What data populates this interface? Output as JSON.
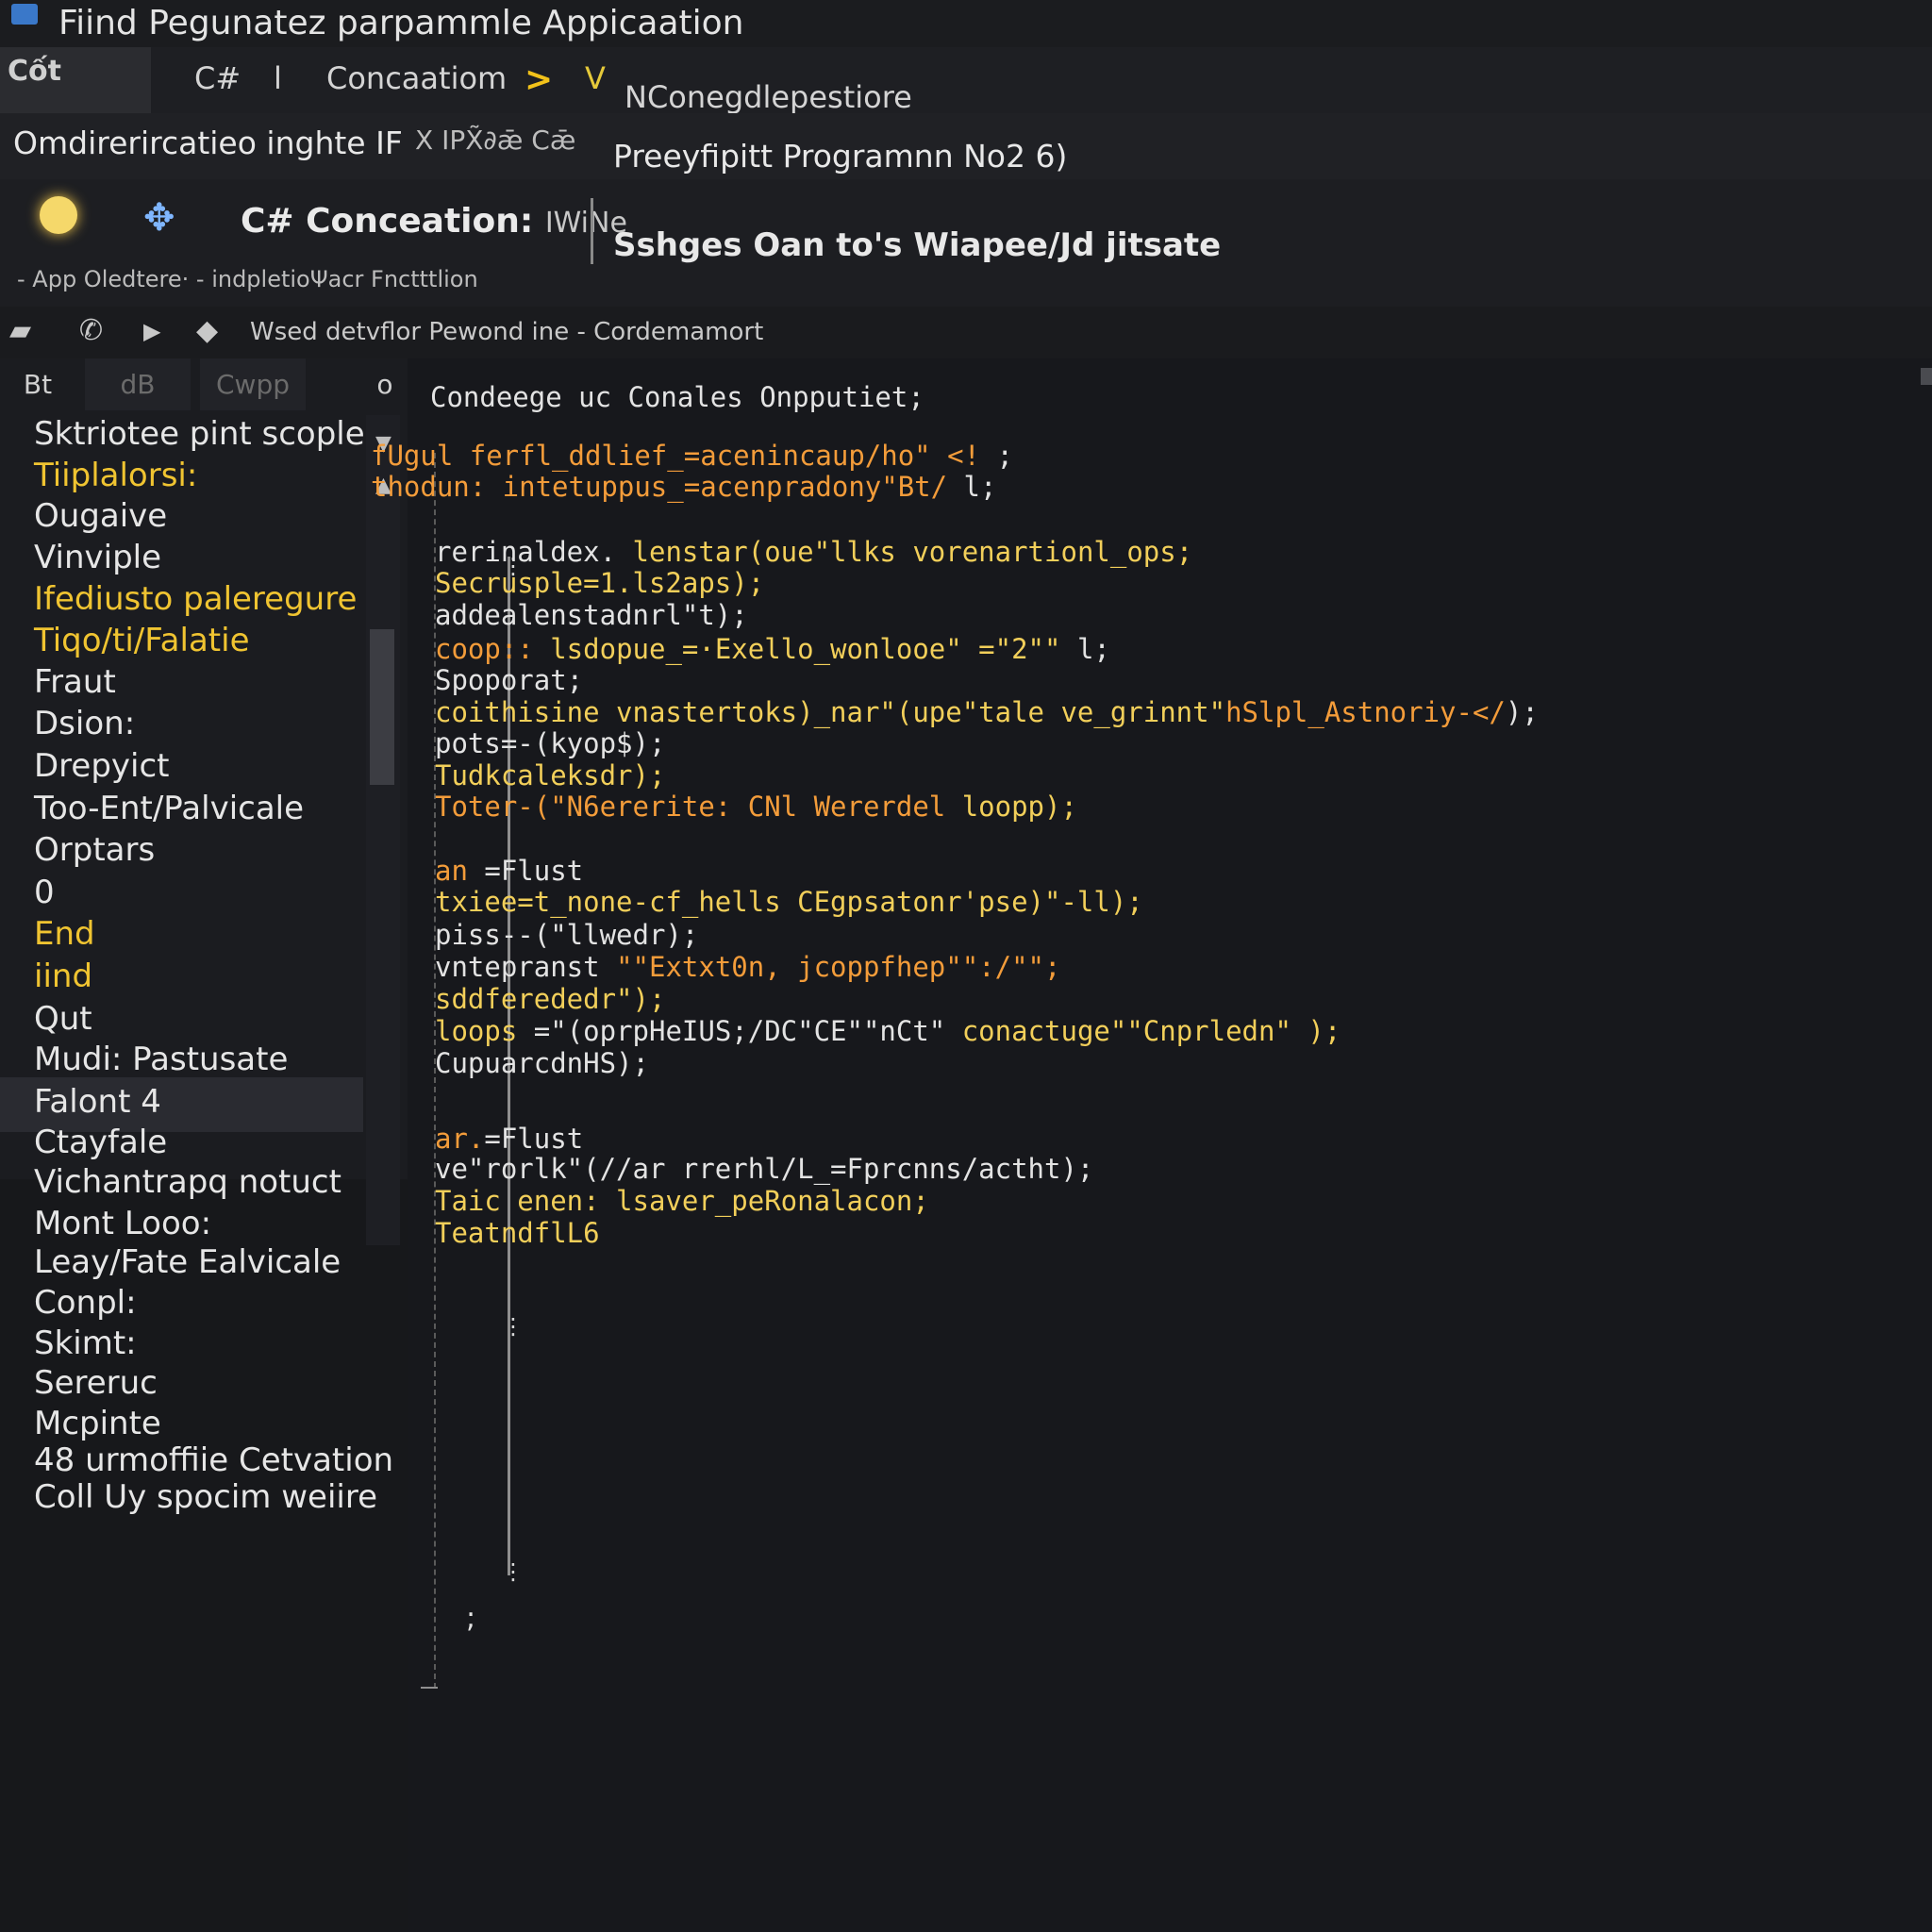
{
  "window": {
    "title": "Fiind Pegunatez parpammle Appicaation"
  },
  "tabbar": {
    "first_tab": "Cốt",
    "crumbs": [
      "C#",
      "l",
      "Concaatiom",
      "V",
      "NConegdlepestiore"
    ],
    "separator": ">"
  },
  "header2": {
    "left": "Omdirerircatieo inghte IF",
    "middle": "X IPX̃∂ǣ  Cǣ",
    "right": "Preeyfipitt Programnn No2 6)"
  },
  "header3": {
    "title": "C# Conceation:",
    "title_suffix": "IWiNe",
    "right": "Sshges Oan to's Wiapee/Jd jitsate",
    "breadcrumb": "- App Oledtere·  -  indpletioΨacr Fnctttlion"
  },
  "toolbar": {
    "icons": [
      "chat-icon",
      "phone-icon",
      "play-icon",
      "shield-icon"
    ],
    "text": "Wsed detvflor Pewond ine  -  Cordemamort"
  },
  "sidebar": {
    "tabs": [
      "Bt",
      "dB",
      "Cwpp",
      "o"
    ],
    "items": [
      {
        "label": "Sktriotee pint scoples",
        "style": "normal"
      },
      {
        "label": "Tiiplalorsi:",
        "style": "hl"
      },
      {
        "label": "Ougaive",
        "style": "normal"
      },
      {
        "label": "Vinviple",
        "style": "normal"
      },
      {
        "label": "Ifediusto paleregure",
        "style": "hl"
      },
      {
        "label": "Tiqo/ti/Falatie",
        "style": "hl"
      },
      {
        "label": "Fraut",
        "style": "normal"
      },
      {
        "label": "Dsion:",
        "style": "normal"
      },
      {
        "label": "Drepyict",
        "style": "normal"
      },
      {
        "label": "Too-Ent/Palvicale",
        "style": "normal"
      },
      {
        "label": "Orptars",
        "style": "normal"
      },
      {
        "label": "0",
        "style": "normal"
      },
      {
        "label": "End",
        "style": "sel"
      },
      {
        "label": "iind",
        "style": "hl"
      },
      {
        "label": "Qut",
        "style": "normal"
      },
      {
        "label": "Mudi: Pastusate",
        "style": "normal"
      },
      {
        "label": "Falont 4",
        "style": "normal"
      },
      {
        "label": "Ctayfale",
        "style": "normal"
      },
      {
        "label": "Vichantrapq notuct",
        "style": "normal"
      },
      {
        "label": "Mont Looo:",
        "style": "normal"
      },
      {
        "label": "Leay/Fate Ealvicale",
        "style": "normal"
      },
      {
        "label": "Conpl:",
        "style": "normal"
      },
      {
        "label": "Skimt:",
        "style": "normal"
      },
      {
        "label": "Sereruc",
        "style": "normal"
      },
      {
        "label": "Mcpinte",
        "style": "normal"
      },
      {
        "label": "48 urmoffiie Cetvation",
        "style": "normal"
      },
      {
        "label": "Coll Uy spocim weiire",
        "style": "normal"
      }
    ]
  },
  "editor": {
    "header": "Condeege uc Conales Onpputiet;",
    "lines": [
      {
        "segments": [
          {
            "t": "fUgul ferfl_ddlief_=acenincaup/ho\" <!",
            "c": "or"
          },
          {
            "t": " ;",
            "c": "wh"
          }
        ]
      },
      {
        "segments": [
          {
            "t": "thodun: intetuppus_=acenpradony\"Bt/",
            "c": "or"
          },
          {
            "t": " l;",
            "c": "wh"
          }
        ]
      },
      {
        "segments": [
          {
            "t": "rerinaldex.",
            "c": "wh"
          },
          {
            "t": " lenstar(oue\"llks ",
            "c": "yl"
          },
          {
            "t": "vorenartionl_ops;",
            "c": "yl"
          }
        ]
      },
      {
        "segments": [
          {
            "t": "Secrusple=1.ls2aps);",
            "c": "yl"
          }
        ]
      },
      {
        "segments": [
          {
            "t": "addealenstadnrl\"t);",
            "c": "wh"
          }
        ]
      },
      {
        "segments": [
          {
            "t": "coop::",
            "c": "or"
          },
          {
            "t": " lsdopue_=·",
            "c": "yl"
          },
          {
            "t": "Exello_wonlooe\" =\"2\"\"",
            "c": "yl"
          },
          {
            "t": " l;",
            "c": "wh"
          }
        ]
      },
      {
        "segments": [
          {
            "t": "Spoporat;",
            "c": "wh"
          }
        ]
      },
      {
        "segments": [
          {
            "t": "coithisine vnastertoks)_nar\"(upe\"tale ve_grinnt\"",
            "c": "yl"
          },
          {
            "t": "hSlpl_Astnoriy-</",
            "c": "or"
          },
          {
            "t": ");",
            "c": "wh"
          }
        ]
      },
      {
        "segments": [
          {
            "t": "pots=-(kyop$);",
            "c": "wh"
          }
        ]
      },
      {
        "segments": [
          {
            "t": "Tudkcaleksdr);",
            "c": "yl"
          }
        ]
      },
      {
        "segments": [
          {
            "t": "Toter-(\"N6ererite: CNl Wererdel ",
            "c": "or"
          },
          {
            "t": "loopp);",
            "c": "yl"
          }
        ]
      },
      {
        "segments": [
          {
            "t": "an",
            "c": "or"
          },
          {
            "t": " =Flust",
            "c": "wh"
          }
        ]
      },
      {
        "segments": [
          {
            "t": "txiee=t_none-cf_hells ",
            "c": "yl"
          },
          {
            "t": "CEgpsatonr'pse)\"-ll);",
            "c": "yl"
          }
        ]
      },
      {
        "segments": [
          {
            "t": "piss--(\"llwedr);",
            "c": "wh"
          }
        ]
      },
      {
        "segments": [
          {
            "t": "vntepranst ",
            "c": "wh"
          },
          {
            "t": "\"\"Extxt0n, jcoppfhep\"\":/\"\";",
            "c": "or"
          }
        ]
      },
      {
        "segments": [
          {
            "t": "sddferededr\");",
            "c": "yl"
          }
        ]
      },
      {
        "segments": [
          {
            "t": "loops",
            "c": "yl"
          },
          {
            "t": " =\"(oprpHeIUS;/DC\"CE\"\"nCt\"",
            "c": "wh"
          },
          {
            "t": " conactuge\"\"Cnprledn\" );",
            "c": "yl"
          }
        ]
      },
      {
        "segments": [
          {
            "t": "CupuarcdnHS);",
            "c": "wh"
          }
        ]
      },
      {
        "segments": [
          {
            "t": "ar.",
            "c": "or"
          },
          {
            "t": "=Flust",
            "c": "wh"
          }
        ]
      },
      {
        "segments": [
          {
            "t": "ve\"rorlk\"(//ar rrerhl/L_=Fprcnns/actht);",
            "c": "wh"
          }
        ]
      },
      {
        "segments": [
          {
            "t": "Taic enen: lsaver_peRonalacon;",
            "c": "yl"
          }
        ]
      },
      {
        "segments": [
          {
            "t": "TeatndflL6",
            "c": "yl"
          }
        ]
      }
    ],
    "closing": ";"
  }
}
